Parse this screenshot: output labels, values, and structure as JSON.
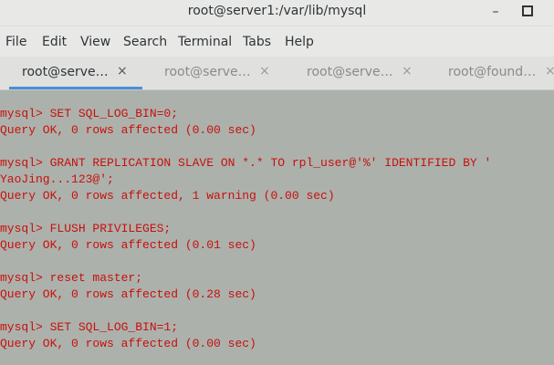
{
  "window": {
    "title": "root@server1:/var/lib/mysql",
    "minimize_glyph": "–"
  },
  "menu": [
    "File",
    "Edit",
    "View",
    "Search",
    "Terminal",
    "Tabs",
    "Help"
  ],
  "tabs": [
    {
      "label": "root@serve…",
      "close": "×",
      "active": true
    },
    {
      "label": "root@serve…",
      "close": "×",
      "active": false
    },
    {
      "label": "root@serve…",
      "close": "×",
      "active": false
    },
    {
      "label": "root@found…",
      "close": "×",
      "active": false
    }
  ],
  "terminal": {
    "text_color": "#c7100e",
    "background": "#adb1ab",
    "lines": [
      "mysql> SET SQL_LOG_BIN=0;",
      "Query OK, 0 rows affected (0.00 sec)",
      "",
      "mysql> GRANT REPLICATION SLAVE ON *.* TO rpl_user@'%' IDENTIFIED BY '",
      "YaoJing...123@';",
      "Query OK, 0 rows affected, 1 warning (0.00 sec)",
      "",
      "mysql> FLUSH PRIVILEGES;",
      "Query OK, 0 rows affected (0.01 sec)",
      "",
      "mysql> reset master;",
      "Query OK, 0 rows affected (0.28 sec)",
      "",
      "mysql> SET SQL_LOG_BIN=1;",
      "Query OK, 0 rows affected (0.00 sec)"
    ]
  }
}
